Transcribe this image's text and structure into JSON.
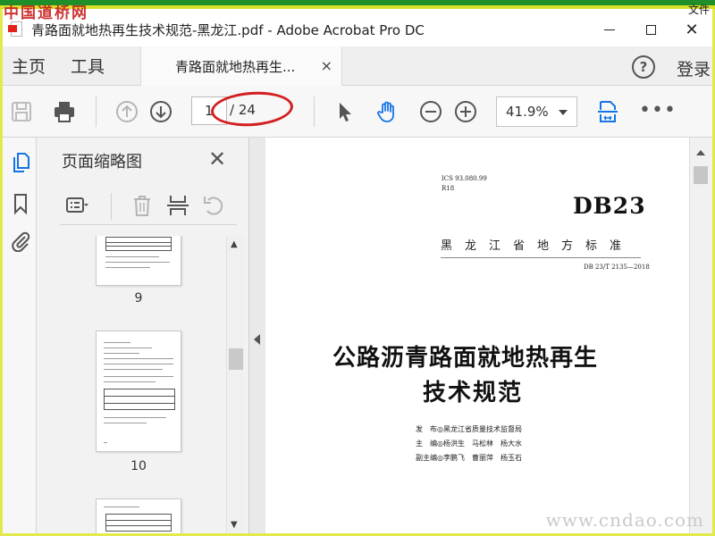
{
  "watermarks": {
    "top_left": "中国道桥网",
    "top_right": "文件",
    "bottom_right": "www.cndao.com"
  },
  "window": {
    "title": "青路面就地热再生技术规范-黑龙江.pdf - Adobe Acrobat Pro DC",
    "icon": "acrobat-pdf-icon",
    "close_glyph": "✕"
  },
  "tabs": {
    "home": "主页",
    "tools": "工具",
    "document": "青路面就地热再生...",
    "close_glyph": "×",
    "help_glyph": "?",
    "login": "登录"
  },
  "toolbar": {
    "page_current": "1",
    "page_total": "/ 24",
    "zoom": "41.9%",
    "more": "•••",
    "icons": [
      "save-icon",
      "print-icon",
      "page-up-icon",
      "page-down-icon",
      "select-cursor-icon",
      "hand-tool-icon",
      "zoom-out-icon",
      "zoom-in-icon",
      "fit-page-icon"
    ]
  },
  "left_rail": {
    "icons": [
      "page-thumbnails-icon",
      "bookmark-icon",
      "attachment-icon"
    ],
    "active_color": "#1473e6"
  },
  "thumbnails_panel": {
    "title": "页面缩略图",
    "close_glyph": "✕",
    "pages": [
      {
        "label": "9"
      },
      {
        "label": "10"
      },
      {
        "label": ""
      }
    ]
  },
  "document": {
    "ics": "ICS 93.080.99",
    "code": "R18",
    "standard": "DB23",
    "province": "黑龙江省地方标准",
    "standard_number": "DB 23/T 2135—2018",
    "title_line1": "公路沥青路面就地热再生",
    "title_line2": "技术规范",
    "publisher": "发　布◎黑龙江省质量技术监督局",
    "editor": "主　编◎杨洪生　马松林　杨大水",
    "associate_editor": "副主编◎李鹏飞　曹丽萍　杨玉石"
  },
  "colors": {
    "accent_blue": "#1473e6",
    "annotation_red": "#d21f1f",
    "frame_green": "#1f8f2a",
    "frame_yellow": "#e2e94b"
  }
}
